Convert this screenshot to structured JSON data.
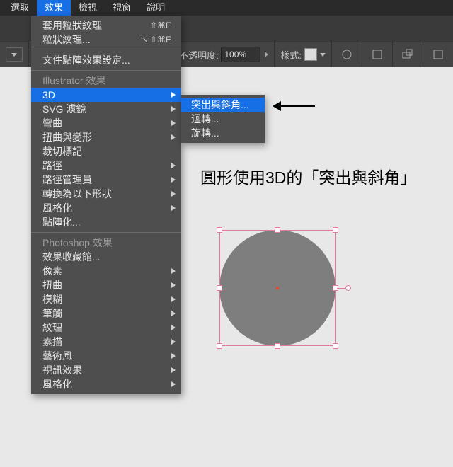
{
  "menubar": {
    "items": [
      "選取",
      "效果",
      "檢視",
      "視窗",
      "說明"
    ],
    "activeIndex": 1
  },
  "optbar": {
    "opacity_label": "不透明度:",
    "opacity_value": "100%",
    "style_label": "樣式:"
  },
  "menu": {
    "top": [
      {
        "label": "套用粒狀紋理",
        "shortcut": "⇧⌘E"
      },
      {
        "label": "粒狀紋理...",
        "shortcut": "⌥⇧⌘E"
      }
    ],
    "settings_label": "文件點陣效果設定...",
    "header_ai": "Illustrator 效果",
    "ai": [
      {
        "label": "3D",
        "arrow": true,
        "hover": true
      },
      {
        "label": "SVG 濾鏡",
        "arrow": true
      },
      {
        "label": "彎曲",
        "arrow": true
      },
      {
        "label": "扭曲與變形",
        "arrow": true
      },
      {
        "label": "裁切標記"
      },
      {
        "label": "路徑",
        "arrow": true
      },
      {
        "label": "路徑管理員",
        "arrow": true
      },
      {
        "label": "轉換為以下形狀",
        "arrow": true
      },
      {
        "label": "風格化",
        "arrow": true
      },
      {
        "label": "點陣化..."
      }
    ],
    "header_ps": "Photoshop 效果",
    "ps": [
      {
        "label": "效果收藏館..."
      },
      {
        "label": "像素",
        "arrow": true
      },
      {
        "label": "扭曲",
        "arrow": true
      },
      {
        "label": "模糊",
        "arrow": true
      },
      {
        "label": "筆觸",
        "arrow": true
      },
      {
        "label": "紋理",
        "arrow": true
      },
      {
        "label": "素描",
        "arrow": true
      },
      {
        "label": "藝術風",
        "arrow": true
      },
      {
        "label": "視訊效果",
        "arrow": true
      },
      {
        "label": "風格化",
        "arrow": true
      }
    ]
  },
  "submenu": {
    "items": [
      {
        "label": "突出與斜角...",
        "hover": true
      },
      {
        "label": "迴轉..."
      },
      {
        "label": "旋轉..."
      }
    ]
  },
  "annotation": "圓形使用3D的「突出與斜角」"
}
